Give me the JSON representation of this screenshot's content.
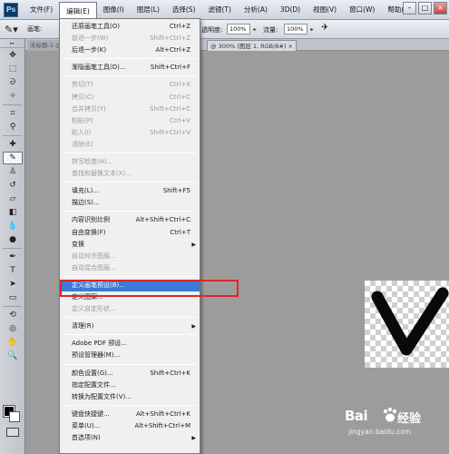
{
  "app": {
    "logo_text": "Ps"
  },
  "menubar": {
    "items": [
      "文件(F)",
      "编辑(E)",
      "图像(I)",
      "图层(L)",
      "选择(S)",
      "滤镜(T)",
      "分析(A)",
      "3D(D)",
      "视图(V)",
      "窗口(W)",
      "帮助(H)"
    ],
    "window_controls": [
      "–",
      "□",
      "×"
    ]
  },
  "options_bar": {
    "brush_label": "画笔:",
    "opacity_label": "透明度:",
    "opacity_value": "100%",
    "flow_label": "流量:",
    "flow_value": "100%",
    "extra_field_value": "100%"
  },
  "document_tabs": [
    {
      "label": "未标题-1 @ ..."
    },
    {
      "label": "@ 300% (图层 1, RGB/8#) ×"
    }
  ],
  "edit_menu": {
    "items": [
      {
        "label": "还原画笔工具(O)",
        "shortcut": "Ctrl+Z",
        "enabled": true
      },
      {
        "label": "前进一步(W)",
        "shortcut": "Shift+Ctrl+Z",
        "enabled": false
      },
      {
        "label": "后退一步(K)",
        "shortcut": "Alt+Ctrl+Z",
        "enabled": true
      },
      {
        "separator": true
      },
      {
        "label": "渐隐画笔工具(D)...",
        "shortcut": "Shift+Ctrl+F",
        "enabled": true
      },
      {
        "separator": true
      },
      {
        "label": "剪切(T)",
        "shortcut": "Ctrl+X",
        "enabled": false
      },
      {
        "label": "拷贝(C)",
        "shortcut": "Ctrl+C",
        "enabled": false
      },
      {
        "label": "合并拷贝(Y)",
        "shortcut": "Shift+Ctrl+C",
        "enabled": false
      },
      {
        "label": "粘贴(P)",
        "shortcut": "Ctrl+V",
        "enabled": false
      },
      {
        "label": "贴入(I)",
        "shortcut": "Shift+Ctrl+V",
        "enabled": false
      },
      {
        "label": "清除(E)",
        "shortcut": "",
        "enabled": false
      },
      {
        "separator": true
      },
      {
        "label": "拼写检查(H)...",
        "shortcut": "",
        "enabled": false
      },
      {
        "label": "查找和替换文本(X)...",
        "shortcut": "",
        "enabled": false
      },
      {
        "separator": true
      },
      {
        "label": "填充(L)...",
        "shortcut": "Shift+F5",
        "enabled": true
      },
      {
        "label": "描边(S)...",
        "shortcut": "",
        "enabled": true
      },
      {
        "separator": true
      },
      {
        "label": "内容识别比例",
        "shortcut": "Alt+Shift+Ctrl+C",
        "enabled": true
      },
      {
        "label": "自由变换(F)",
        "shortcut": "Ctrl+T",
        "enabled": true
      },
      {
        "label": "变换",
        "shortcut": "",
        "enabled": true,
        "submenu": true
      },
      {
        "label": "自动对齐图层...",
        "shortcut": "",
        "enabled": false
      },
      {
        "label": "自动混合图层...",
        "shortcut": "",
        "enabled": false
      },
      {
        "separator": true
      },
      {
        "label": "定义画笔预设(B)...",
        "shortcut": "",
        "enabled": true,
        "highlighted": true
      },
      {
        "label": "定义图案...",
        "shortcut": "",
        "enabled": true
      },
      {
        "label": "定义自定形状...",
        "shortcut": "",
        "enabled": false
      },
      {
        "separator": true
      },
      {
        "label": "清理(R)",
        "shortcut": "",
        "enabled": true,
        "submenu": true
      },
      {
        "separator": true
      },
      {
        "label": "Adobe PDF 预设...",
        "shortcut": "",
        "enabled": true
      },
      {
        "label": "预设管理器(M)...",
        "shortcut": "",
        "enabled": true
      },
      {
        "separator": true
      },
      {
        "label": "颜色设置(G)...",
        "shortcut": "Shift+Ctrl+K",
        "enabled": true
      },
      {
        "label": "指定配置文件...",
        "shortcut": "",
        "enabled": true
      },
      {
        "label": "转换为配置文件(V)...",
        "shortcut": "",
        "enabled": true
      },
      {
        "separator": true
      },
      {
        "label": "键盘快捷键...",
        "shortcut": "Alt+Shift+Ctrl+K",
        "enabled": true
      },
      {
        "label": "菜单(U)...",
        "shortcut": "Alt+Shift+Ctrl+M",
        "enabled": true
      },
      {
        "label": "首选项(N)",
        "shortcut": "",
        "enabled": true,
        "submenu": true
      }
    ]
  },
  "watermark": {
    "logo": "Bai",
    "jingyan": "经验",
    "url": "jingyan.baidu.com"
  },
  "colors": {
    "highlight": "#3a7bd5",
    "annotation": "#e02424",
    "foreground": "#000000",
    "background": "#ffffff"
  },
  "tools": [
    "move-icon",
    "marquee-icon",
    "lasso-icon",
    "magic-wand-icon",
    "crop-icon",
    "eyedropper-icon",
    "healing-icon",
    "brush-icon",
    "clone-stamp-icon",
    "history-brush-icon",
    "eraser-icon",
    "gradient-icon",
    "blur-icon",
    "dodge-icon",
    "pen-icon",
    "type-icon",
    "path-select-icon",
    "shape-icon",
    "3d-rotate-icon",
    "3d-orbit-icon",
    "hand-icon",
    "zoom-icon"
  ]
}
